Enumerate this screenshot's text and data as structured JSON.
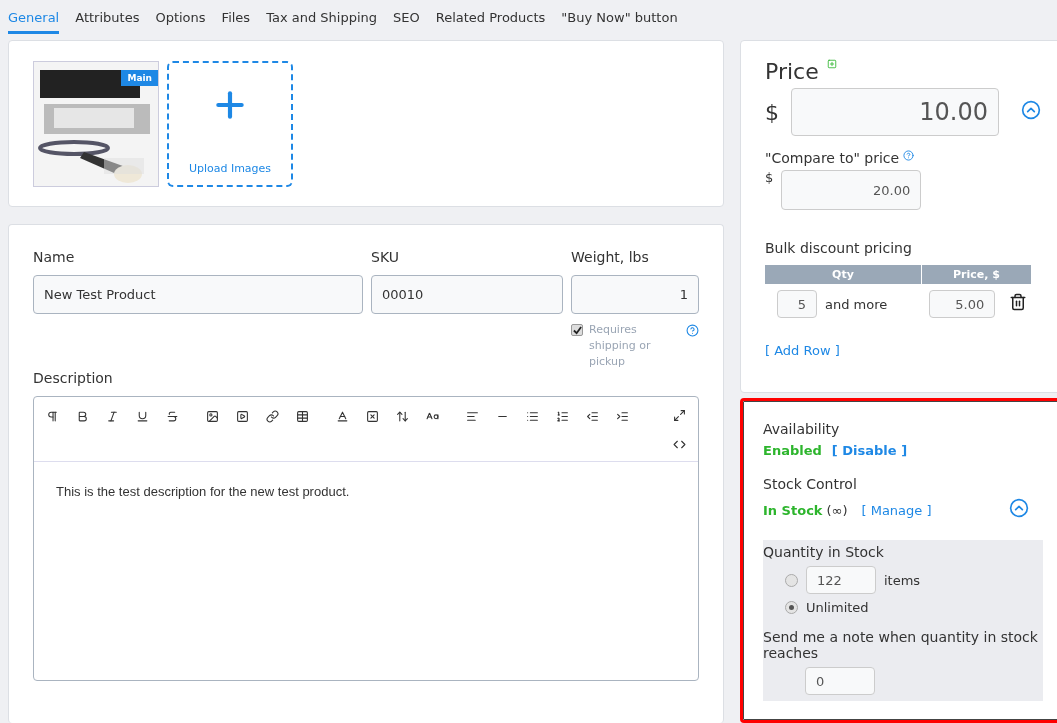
{
  "tabs": [
    {
      "label": "General",
      "selected": true
    },
    {
      "label": "Attributes",
      "selected": false
    },
    {
      "label": "Options",
      "selected": false
    },
    {
      "label": "Files",
      "selected": false
    },
    {
      "label": "Tax and Shipping",
      "selected": false
    },
    {
      "label": "SEO",
      "selected": false
    },
    {
      "label": "Related Products",
      "selected": false
    },
    {
      "label": "\"Buy Now\" button",
      "selected": false
    }
  ],
  "images": {
    "main_badge": "Main",
    "upload_label": "Upload Images"
  },
  "fields": [
    {
      "label": "Name",
      "value": "New Test Product",
      "kind": "text"
    },
    {
      "label": "SKU",
      "value": "00010",
      "kind": "text"
    },
    {
      "label": "Weight, lbs",
      "value": "1",
      "kind": "number"
    }
  ],
  "requires_shipping": {
    "label": "Requires shipping or pickup",
    "checked": true
  },
  "description": {
    "label": "Description",
    "text": "This is the test description for the new test product."
  },
  "price": {
    "title": "Price",
    "currency": "$",
    "value": "10.00",
    "compare_label": "\"Compare to\" price",
    "compare_currency": "$",
    "compare_value": "20.00",
    "bulk_title": "Bulk discount pricing",
    "columns": [
      "Qty",
      "Price, $"
    ],
    "rows": [
      {
        "qty": "5",
        "suffix": "and more",
        "price": "5.00"
      }
    ],
    "add_row": "[ Add Row ]"
  },
  "availability": {
    "highlighted": true,
    "label": "Availability",
    "status": "Enabled",
    "action": "[ Disable ]",
    "stock_label": "Stock Control",
    "stock_status": "In Stock",
    "stock_note": "(∞)",
    "stock_action": "[ Manage ]",
    "quantity_title": "Quantity in Stock",
    "options": [
      {
        "kind": "number",
        "value": "122",
        "suffix": "items",
        "selected": false
      },
      {
        "kind": "label",
        "label": "Unlimited",
        "selected": true
      }
    ],
    "note_label": "Send me a note when quantity in stock reaches",
    "note_value": "0"
  }
}
